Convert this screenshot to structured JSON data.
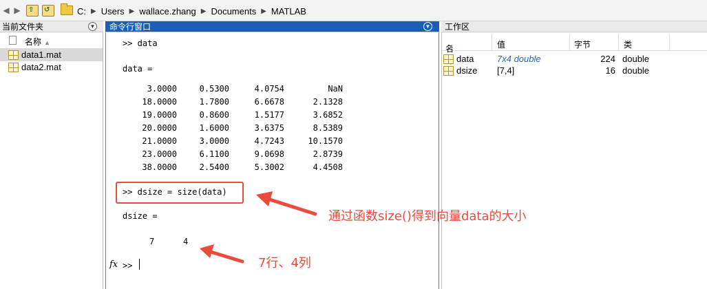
{
  "address_bar": {
    "path": [
      "C:",
      "Users",
      "wallace.zhang",
      "Documents",
      "MATLAB"
    ]
  },
  "file_browser": {
    "title": "当前文件夹",
    "column_name": "名称",
    "files": [
      {
        "name": "data1.mat",
        "selected": true
      },
      {
        "name": "data2.mat",
        "selected": false
      }
    ]
  },
  "command_window": {
    "title": "命令行窗口",
    "cmd1": ">> data",
    "out1_label": "data =",
    "matrix": [
      [
        "3.0000",
        "0.5300",
        "4.0754",
        "NaN"
      ],
      [
        "18.0000",
        "1.7800",
        "6.6678",
        "2.1328"
      ],
      [
        "19.0000",
        "0.8600",
        "1.5177",
        "3.6852"
      ],
      [
        "20.0000",
        "1.6000",
        "3.6375",
        "8.5389"
      ],
      [
        "21.0000",
        "3.0000",
        "4.7243",
        "10.1570"
      ],
      [
        "23.0000",
        "6.1100",
        "9.0698",
        "2.8739"
      ],
      [
        "38.0000",
        "2.5400",
        "5.3002",
        "4.4508"
      ]
    ],
    "cmd2": ">> dsize = size(data)",
    "out2_label": "dsize =",
    "dsize_values": [
      "7",
      "4"
    ],
    "fx_label": "fx",
    "prompt": ">>"
  },
  "workspace": {
    "title": "工作区",
    "columns": [
      "名称",
      "值",
      "字节",
      "类"
    ],
    "variables": [
      {
        "name": "data",
        "value": "7x4 double",
        "bytes": "224",
        "class": "double"
      },
      {
        "name": "dsize",
        "value": "[7,4]",
        "bytes": "16",
        "class": "double"
      }
    ]
  },
  "annotations": {
    "note_size": "通过函数size()得到向量data的大小",
    "note_rows_cols": "7行、4列",
    "color": "#e84c3d"
  }
}
